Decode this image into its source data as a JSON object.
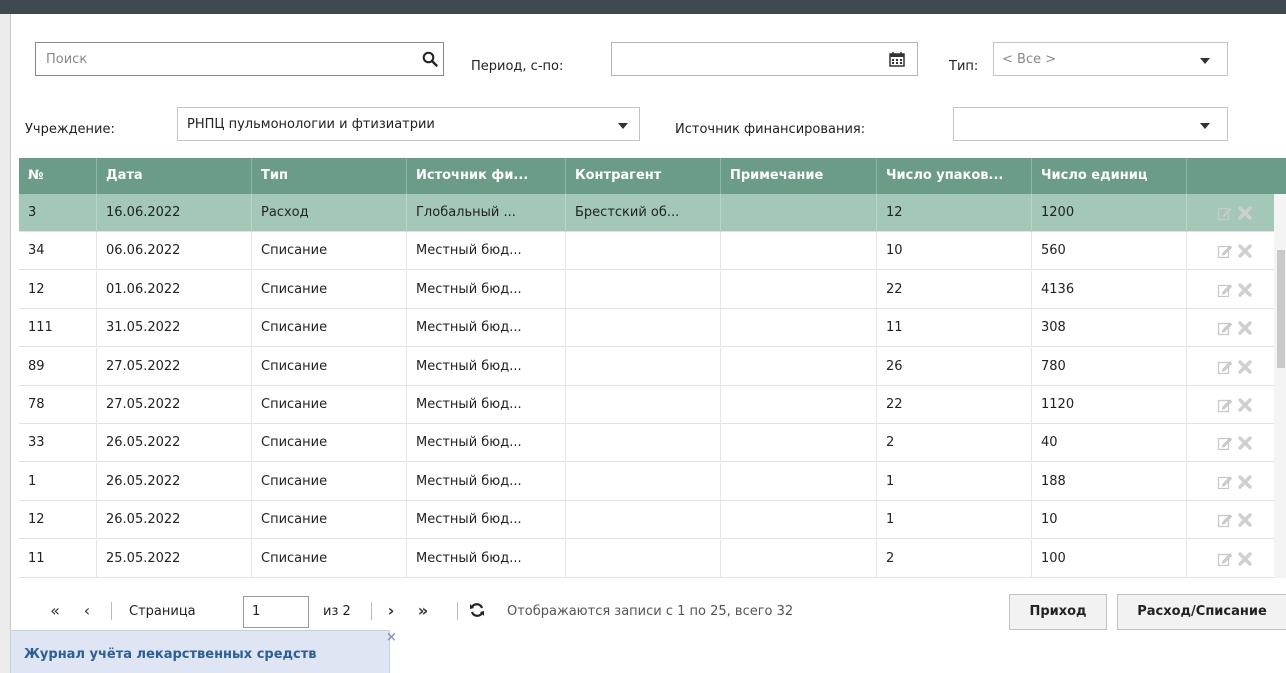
{
  "filters": {
    "search_placeholder": "Поиск",
    "period_label": "Период, с-по:",
    "period_value": "",
    "type_label": "Тип:",
    "type_value": "< Все >",
    "institution_label": "Учреждение:",
    "institution_value": "РНПЦ пульмонологии и фтизиатрии",
    "funding_label": "Источник финансирования:",
    "funding_value": ""
  },
  "table": {
    "columns": [
      "№",
      "Дата",
      "Тип",
      "Источник фи...",
      "Контрагент",
      "Примечание",
      "Число упаков...",
      "Число единиц"
    ],
    "rows": [
      [
        "3",
        "16.06.2022",
        "Расход",
        "Глобальный ...",
        "Брестский об...",
        "",
        "12",
        "1200"
      ],
      [
        "34",
        "06.06.2022",
        "Списание",
        "Местный бюд...",
        "",
        "",
        "10",
        "560"
      ],
      [
        "12",
        "01.06.2022",
        "Списание",
        "Местный бюд...",
        "",
        "",
        "22",
        "4136"
      ],
      [
        "111",
        "31.05.2022",
        "Списание",
        "Местный бюд...",
        "",
        "",
        "11",
        "308"
      ],
      [
        "89",
        "27.05.2022",
        "Списание",
        "Местный бюд...",
        "",
        "",
        "26",
        "780"
      ],
      [
        "78",
        "27.05.2022",
        "Списание",
        "Местный бюд...",
        "",
        "",
        "22",
        "1120"
      ],
      [
        "33",
        "26.05.2022",
        "Списание",
        "Местный бюд...",
        "",
        "",
        "2",
        "40"
      ],
      [
        "1",
        "26.05.2022",
        "Списание",
        "Местный бюд...",
        "",
        "",
        "1",
        "188"
      ],
      [
        "12",
        "26.05.2022",
        "Списание",
        "Местный бюд...",
        "",
        "",
        "1",
        "10"
      ],
      [
        "11",
        "25.05.2022",
        "Списание",
        "Местный бюд...",
        "",
        "",
        "2",
        "100"
      ]
    ],
    "selected_row": 0
  },
  "pager": {
    "page_label": "Страница",
    "page_value": "1",
    "of_label": "из 2",
    "status": "Отображаются записи с 1 по 25, всего 32",
    "income_button": "Приход",
    "expense_button": "Расход/Списание"
  },
  "tab": {
    "label": "Журнал учёта лекарственных средств",
    "close": "×"
  },
  "colors": {
    "header": "#6b9c88",
    "selected_row": "#a3c8b8",
    "tab_text": "#2a5f99"
  },
  "icons": [
    "search-icon",
    "calendar-icon",
    "chevron-down-icon",
    "edit-icon",
    "delete-icon",
    "first-page-icon",
    "prev-page-icon",
    "next-page-icon",
    "last-page-icon",
    "refresh-icon"
  ]
}
